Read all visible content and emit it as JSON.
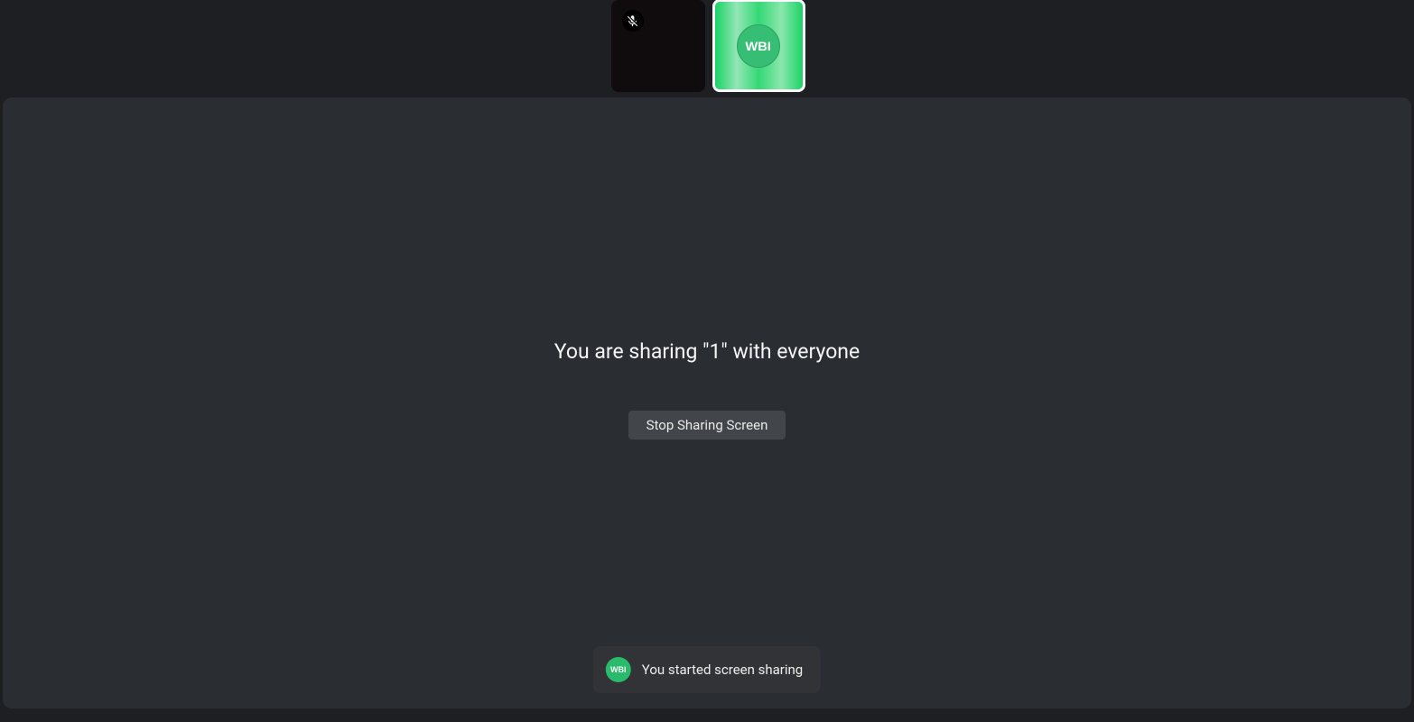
{
  "participants": {
    "self_muted": true,
    "self_avatar_label": "WBI"
  },
  "share": {
    "message": "You are sharing \"1\" with everyone",
    "stop_button_label": "Stop Sharing Screen"
  },
  "toast": {
    "avatar_label": "WBI",
    "text": "You started screen sharing"
  },
  "colors": {
    "background": "#1e1f22",
    "stage": "#2a2d31",
    "avatar_green": "#28bb6b",
    "active_outline": "#ffffff"
  }
}
